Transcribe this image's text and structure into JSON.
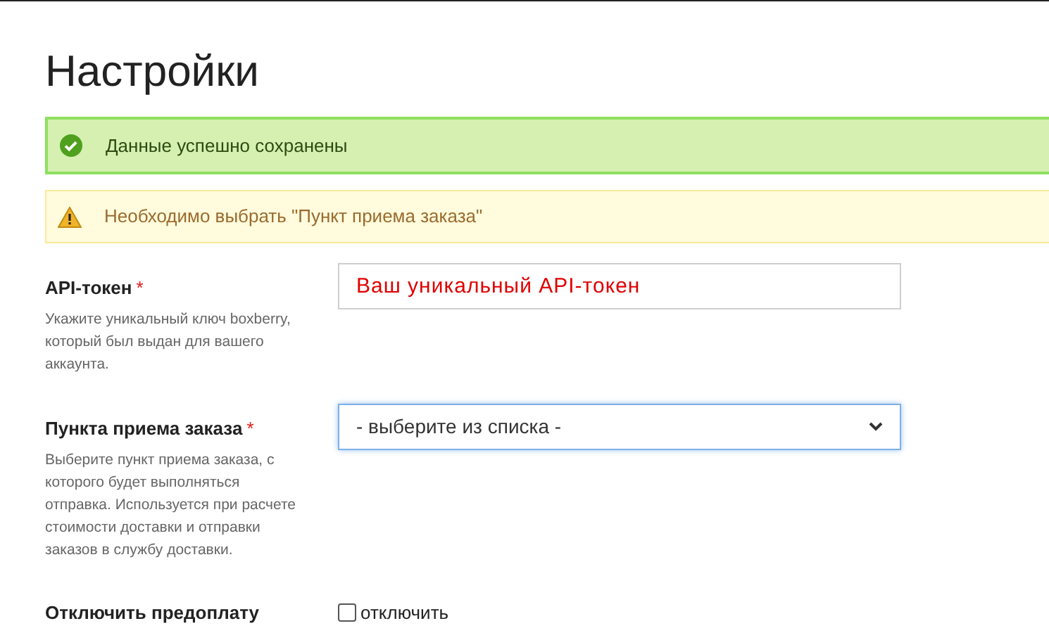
{
  "page": {
    "title": "Настройки"
  },
  "alerts": [
    {
      "kind": "success",
      "text": "Данные успешно сохранены"
    },
    {
      "kind": "warning",
      "text": "Необходимо выбрать \"Пункт приема заказа\""
    }
  ],
  "fields": [
    {
      "kind": "text",
      "label": "API-токен",
      "required_mark": "*",
      "help": "Укажите уникальный ключ boxberry, который был выдан для вашего аккаунта.",
      "placeholder": "Ваш уникальный API-токен"
    },
    {
      "kind": "select",
      "label": "Пункта приема заказа",
      "required_mark": "*",
      "help": "Выберите пункт приема заказа, с которого будет выполняться отправка. Используется при расчете стоимости доставки и отправки заказов в службу доставки.",
      "value": "- выберите из списка -",
      "focused": true
    },
    {
      "kind": "checkbox",
      "label": "Отключить предоплату",
      "option": "отключить",
      "checked": false
    }
  ]
}
